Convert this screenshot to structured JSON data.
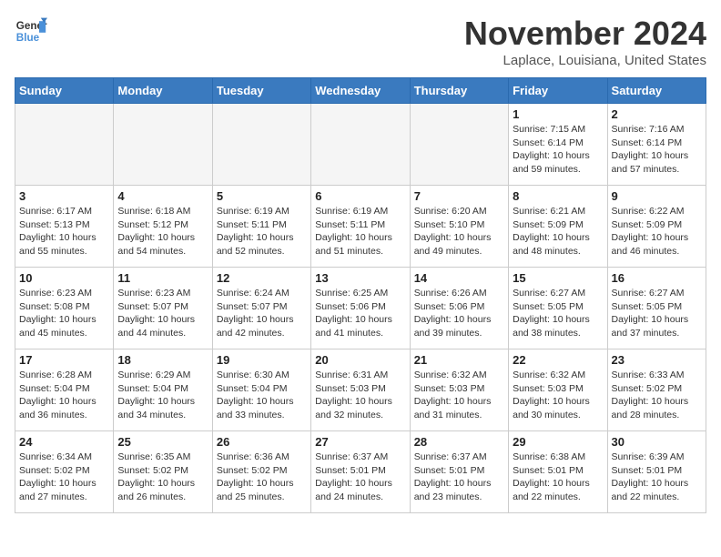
{
  "logo": {
    "line1": "General",
    "line2": "Blue"
  },
  "title": "November 2024",
  "location": "Laplace, Louisiana, United States",
  "weekdays": [
    "Sunday",
    "Monday",
    "Tuesday",
    "Wednesday",
    "Thursday",
    "Friday",
    "Saturday"
  ],
  "weeks": [
    [
      {
        "day": "",
        "info": ""
      },
      {
        "day": "",
        "info": ""
      },
      {
        "day": "",
        "info": ""
      },
      {
        "day": "",
        "info": ""
      },
      {
        "day": "",
        "info": ""
      },
      {
        "day": "1",
        "info": "Sunrise: 7:15 AM\nSunset: 6:14 PM\nDaylight: 10 hours\nand 59 minutes."
      },
      {
        "day": "2",
        "info": "Sunrise: 7:16 AM\nSunset: 6:14 PM\nDaylight: 10 hours\nand 57 minutes."
      }
    ],
    [
      {
        "day": "3",
        "info": "Sunrise: 6:17 AM\nSunset: 5:13 PM\nDaylight: 10 hours\nand 55 minutes."
      },
      {
        "day": "4",
        "info": "Sunrise: 6:18 AM\nSunset: 5:12 PM\nDaylight: 10 hours\nand 54 minutes."
      },
      {
        "day": "5",
        "info": "Sunrise: 6:19 AM\nSunset: 5:11 PM\nDaylight: 10 hours\nand 52 minutes."
      },
      {
        "day": "6",
        "info": "Sunrise: 6:19 AM\nSunset: 5:11 PM\nDaylight: 10 hours\nand 51 minutes."
      },
      {
        "day": "7",
        "info": "Sunrise: 6:20 AM\nSunset: 5:10 PM\nDaylight: 10 hours\nand 49 minutes."
      },
      {
        "day": "8",
        "info": "Sunrise: 6:21 AM\nSunset: 5:09 PM\nDaylight: 10 hours\nand 48 minutes."
      },
      {
        "day": "9",
        "info": "Sunrise: 6:22 AM\nSunset: 5:09 PM\nDaylight: 10 hours\nand 46 minutes."
      }
    ],
    [
      {
        "day": "10",
        "info": "Sunrise: 6:23 AM\nSunset: 5:08 PM\nDaylight: 10 hours\nand 45 minutes."
      },
      {
        "day": "11",
        "info": "Sunrise: 6:23 AM\nSunset: 5:07 PM\nDaylight: 10 hours\nand 44 minutes."
      },
      {
        "day": "12",
        "info": "Sunrise: 6:24 AM\nSunset: 5:07 PM\nDaylight: 10 hours\nand 42 minutes."
      },
      {
        "day": "13",
        "info": "Sunrise: 6:25 AM\nSunset: 5:06 PM\nDaylight: 10 hours\nand 41 minutes."
      },
      {
        "day": "14",
        "info": "Sunrise: 6:26 AM\nSunset: 5:06 PM\nDaylight: 10 hours\nand 39 minutes."
      },
      {
        "day": "15",
        "info": "Sunrise: 6:27 AM\nSunset: 5:05 PM\nDaylight: 10 hours\nand 38 minutes."
      },
      {
        "day": "16",
        "info": "Sunrise: 6:27 AM\nSunset: 5:05 PM\nDaylight: 10 hours\nand 37 minutes."
      }
    ],
    [
      {
        "day": "17",
        "info": "Sunrise: 6:28 AM\nSunset: 5:04 PM\nDaylight: 10 hours\nand 36 minutes."
      },
      {
        "day": "18",
        "info": "Sunrise: 6:29 AM\nSunset: 5:04 PM\nDaylight: 10 hours\nand 34 minutes."
      },
      {
        "day": "19",
        "info": "Sunrise: 6:30 AM\nSunset: 5:04 PM\nDaylight: 10 hours\nand 33 minutes."
      },
      {
        "day": "20",
        "info": "Sunrise: 6:31 AM\nSunset: 5:03 PM\nDaylight: 10 hours\nand 32 minutes."
      },
      {
        "day": "21",
        "info": "Sunrise: 6:32 AM\nSunset: 5:03 PM\nDaylight: 10 hours\nand 31 minutes."
      },
      {
        "day": "22",
        "info": "Sunrise: 6:32 AM\nSunset: 5:03 PM\nDaylight: 10 hours\nand 30 minutes."
      },
      {
        "day": "23",
        "info": "Sunrise: 6:33 AM\nSunset: 5:02 PM\nDaylight: 10 hours\nand 28 minutes."
      }
    ],
    [
      {
        "day": "24",
        "info": "Sunrise: 6:34 AM\nSunset: 5:02 PM\nDaylight: 10 hours\nand 27 minutes."
      },
      {
        "day": "25",
        "info": "Sunrise: 6:35 AM\nSunset: 5:02 PM\nDaylight: 10 hours\nand 26 minutes."
      },
      {
        "day": "26",
        "info": "Sunrise: 6:36 AM\nSunset: 5:02 PM\nDaylight: 10 hours\nand 25 minutes."
      },
      {
        "day": "27",
        "info": "Sunrise: 6:37 AM\nSunset: 5:01 PM\nDaylight: 10 hours\nand 24 minutes."
      },
      {
        "day": "28",
        "info": "Sunrise: 6:37 AM\nSunset: 5:01 PM\nDaylight: 10 hours\nand 23 minutes."
      },
      {
        "day": "29",
        "info": "Sunrise: 6:38 AM\nSunset: 5:01 PM\nDaylight: 10 hours\nand 22 minutes."
      },
      {
        "day": "30",
        "info": "Sunrise: 6:39 AM\nSunset: 5:01 PM\nDaylight: 10 hours\nand 22 minutes."
      }
    ]
  ]
}
